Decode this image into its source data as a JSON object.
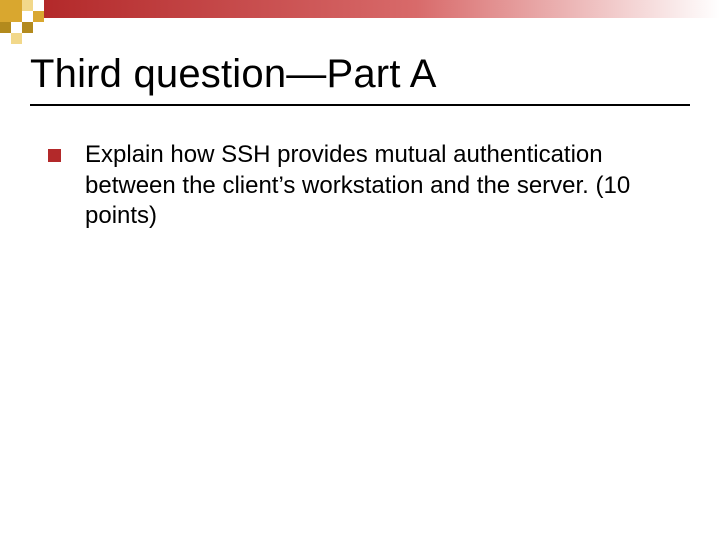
{
  "slide": {
    "title": "Third question—Part A",
    "bullets": [
      {
        "text": "Explain how SSH provides mutual authentication between the client’s workstation and the server.  (10 points)"
      }
    ]
  },
  "theme": {
    "accent": "#b3292a",
    "logo_colors": {
      "dark_gold": "#b38a1d",
      "gold": "#d9a72f",
      "light_gold": "#f2d88a"
    }
  }
}
